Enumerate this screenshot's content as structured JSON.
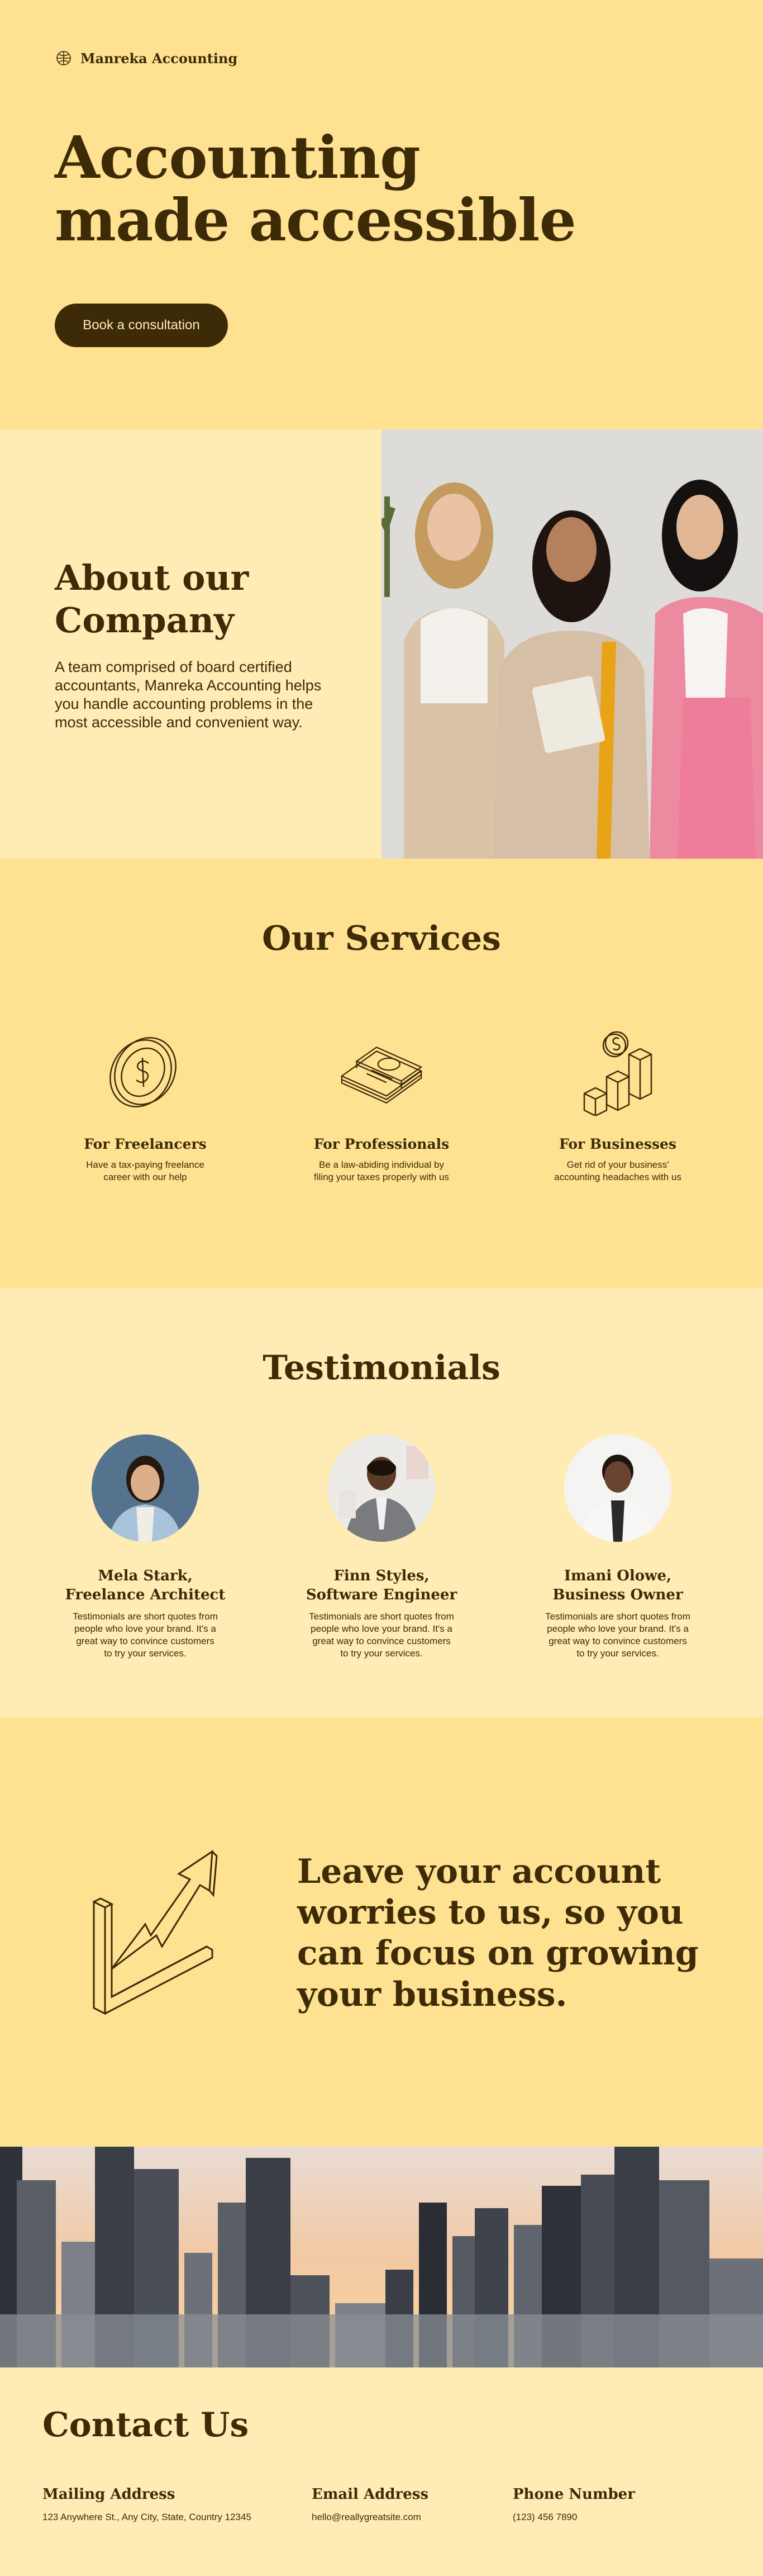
{
  "brand": {
    "name": "Manreka Accounting",
    "icon": "globe-logo-icon"
  },
  "hero": {
    "title_line1": "Accounting",
    "title_line2": "made accessible",
    "cta_label": "Book a consultation"
  },
  "about": {
    "title_line1": "About our",
    "title_line2": "Company",
    "body": "A team comprised of board certified accountants, Manreka Accounting helps you handle accounting problems in the most accessible and convenient way."
  },
  "services": {
    "title": "Our Services",
    "items": [
      {
        "icon": "coin-icon",
        "title": "For Freelancers",
        "desc": "Have a tax-paying freelance career with our help"
      },
      {
        "icon": "cash-stack-icon",
        "title": "For Professionals",
        "desc": "Be a law-abiding individual by filing your taxes properly with us"
      },
      {
        "icon": "bar-chart-coin-icon",
        "title": "For Businesses",
        "desc": "Get rid of your business' accounting headaches with us"
      }
    ]
  },
  "testimonials": {
    "title": "Testimonials",
    "items": [
      {
        "name": "Mela Stark,",
        "role": "Freelance Architect",
        "quote": "Testimonials are short quotes from people who love your brand. It's a great way to convince customers to try your services."
      },
      {
        "name": "Finn Styles,",
        "role": "Software Engineer",
        "quote": "Testimonials are short quotes from people who love your brand. It's a great way to convince customers to try your services."
      },
      {
        "name": "Imani Olowe,",
        "role": "Business Owner",
        "quote": "Testimonials are short quotes from people who love your brand. It's a great way to convince customers to try your services."
      }
    ]
  },
  "growth": {
    "icon": "growth-arrow-icon",
    "text": "Leave your account worries to us, so you can focus on growing your business."
  },
  "contact": {
    "title": "Contact Us",
    "mailing_label": "Mailing Address",
    "mailing_value": "123 Anywhere St., Any City, State, Country 12345",
    "email_label": "Email Address",
    "email_value": "hello@reallygreatsite.com",
    "phone_label": "Phone Number",
    "phone_value": "(123) 456 7890"
  },
  "colors": {
    "bg_yellow": "#FFE192",
    "bg_cream": "#FFEBB4",
    "text_brown": "#3D2B07"
  }
}
